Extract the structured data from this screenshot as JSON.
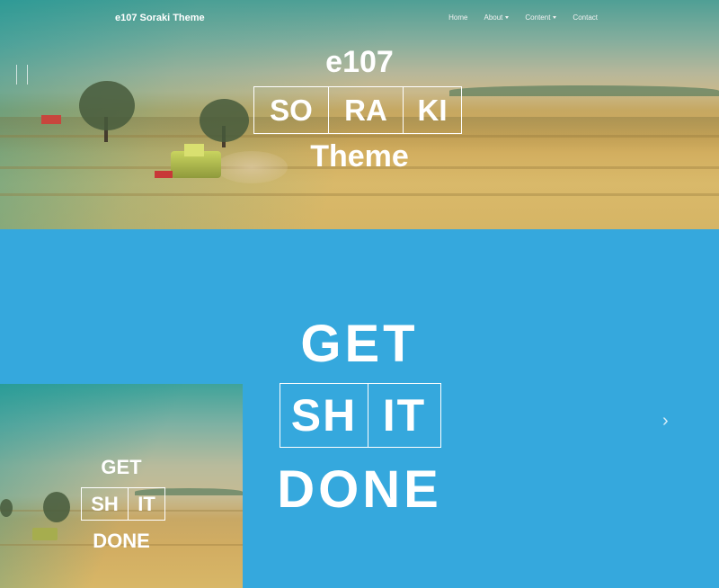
{
  "navbar": {
    "brand": "e107 Soraki Theme",
    "items": [
      {
        "label": "Home",
        "dropdown": false
      },
      {
        "label": "About",
        "dropdown": true
      },
      {
        "label": "Content",
        "dropdown": true
      },
      {
        "label": "Contact",
        "dropdown": false
      }
    ]
  },
  "hero": {
    "title_top": "e107",
    "boxes": [
      "SO",
      "RA",
      "KI"
    ],
    "title_bottom": "Theme"
  },
  "slide": {
    "background_color": "#35a8dd",
    "line1": "GET",
    "boxes": [
      "SH",
      "IT"
    ],
    "line3": "DONE",
    "next_icon": "chevron-right-icon",
    "next_glyph": "›"
  },
  "thumbnail": {
    "line1": "GET",
    "boxes": [
      "SH",
      "IT"
    ],
    "line3": "DONE"
  }
}
